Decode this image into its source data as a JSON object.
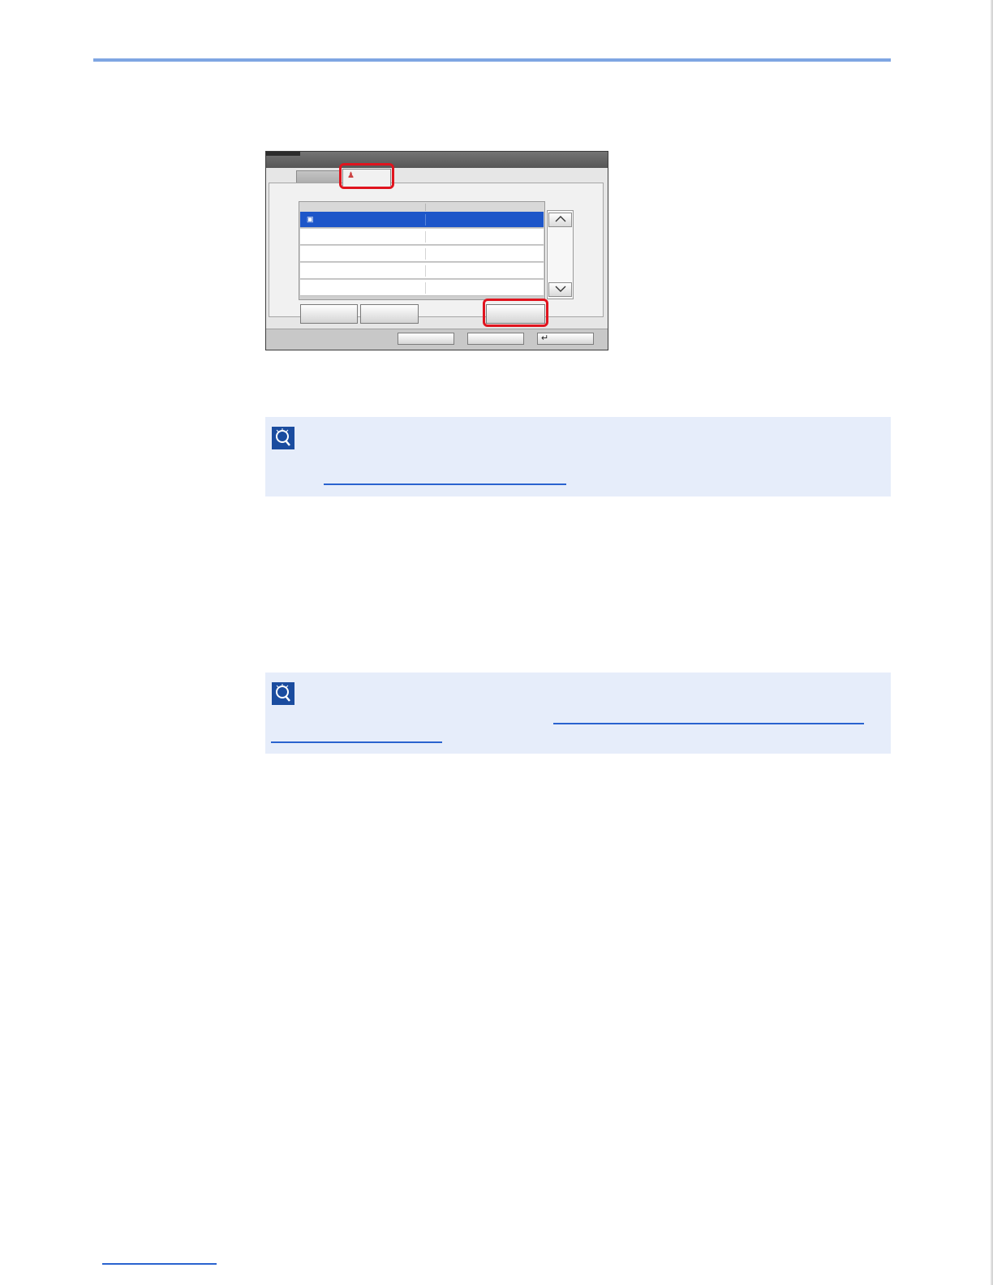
{
  "screen": {
    "tabs": [
      {
        "label": "",
        "icon": "tab-icon-left"
      },
      {
        "label": "",
        "icon": "color-people-icon"
      }
    ],
    "list": {
      "columns": [
        "",
        ""
      ],
      "rows": [
        {
          "col1": "",
          "col2": "",
          "selected": true,
          "icon": "local-host-icon"
        },
        {
          "col1": "",
          "col2": "",
          "selected": false
        },
        {
          "col1": "",
          "col2": "",
          "selected": false
        },
        {
          "col1": "",
          "col2": "",
          "selected": false
        },
        {
          "col1": "",
          "col2": "",
          "selected": false
        }
      ]
    },
    "scroll": {
      "up_icon": "chevron-up-icon",
      "down_icon": "chevron-down-icon"
    },
    "buttons": {
      "left_1": "",
      "left_2": "",
      "highlighted": ""
    },
    "footer": {
      "button_1": "",
      "button_2": "",
      "button_3": "",
      "button_3_icon": "enter-arrow-icon"
    },
    "callout_color": "#e0141e",
    "selected_row_color": "#1d56c9"
  },
  "notes": [
    {
      "icon": "note-lightbulb-icon",
      "text": "",
      "link": ""
    },
    {
      "icon": "note-lightbulb-icon",
      "text": "",
      "link": ""
    }
  ],
  "colors": {
    "header_rule": "#7fa6e2",
    "note_bg": "#e6edfa",
    "link": "#2a63cf"
  }
}
